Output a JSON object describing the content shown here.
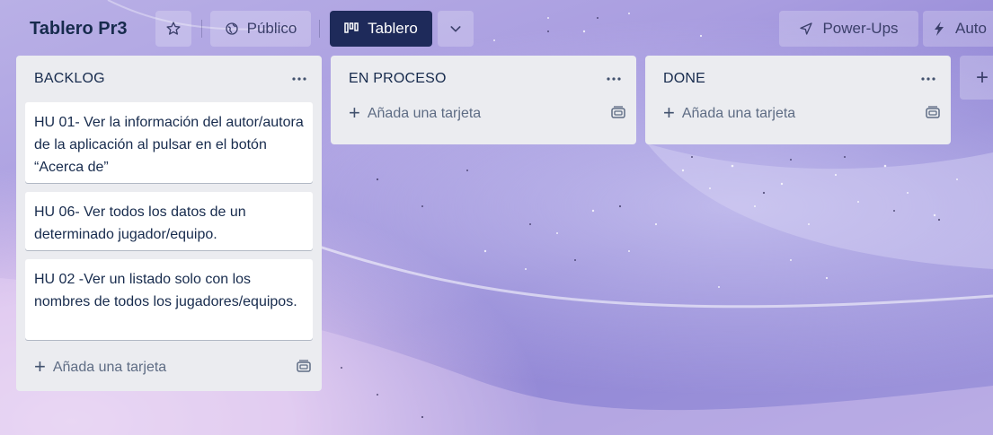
{
  "board": {
    "title": "Tablero Pr3",
    "visibility_label": "Público",
    "view_label": "Tablero",
    "powerups_label": "Power-Ups",
    "automation_label": "Auto"
  },
  "lists": [
    {
      "title": "BACKLOG",
      "cards": [
        "HU 01- Ver la información del autor/autora de la aplicación al pulsar en el botón “Acerca de”",
        "HU 06- Ver todos los datos de un determinado jugador/equipo.",
        "HU 02 -Ver un listado solo con los nombres de todos los jugadores/equipos."
      ],
      "add_card_label": "Añada una tarjeta"
    },
    {
      "title": "EN PROCESO",
      "cards": [],
      "add_card_label": "Añada una tarjeta"
    },
    {
      "title": "DONE",
      "cards": [],
      "add_card_label": "Añada una tarjeta"
    }
  ],
  "add_list_label": "+",
  "icons": {
    "star": "star-icon",
    "visibility": "globe-icon",
    "view": "board-icon",
    "view_switch": "chevron-down-icon",
    "powerups": "rocket-icon",
    "automation": "lightning-icon",
    "list_menu": "more-icon",
    "plus": "plus-icon",
    "template": "card-template-icon"
  },
  "colors": {
    "active_view_bg": "#1e2a5a",
    "list_bg": "#ebecf0",
    "card_bg": "#ffffff",
    "text": "#172b4d"
  }
}
